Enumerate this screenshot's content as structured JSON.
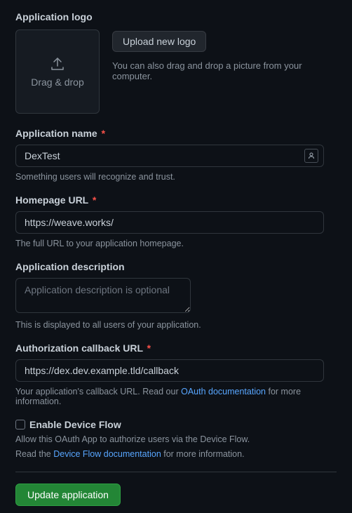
{
  "logo": {
    "heading": "Application logo",
    "dropText": "Drag & drop",
    "uploadButton": "Upload new logo",
    "hint": "You can also drag and drop a picture from your computer."
  },
  "appName": {
    "label": "Application name",
    "value": "DexTest",
    "help": "Something users will recognize and trust."
  },
  "homepage": {
    "label": "Homepage URL",
    "value": "https://weave.works/",
    "help": "The full URL to your application homepage."
  },
  "description": {
    "label": "Application description",
    "placeholder": "Application description is optional",
    "help": "This is displayed to all users of your application."
  },
  "callback": {
    "label": "Authorization callback URL",
    "value": "https://dex.dev.example.tld/callback",
    "helpPrefix": "Your application's callback URL. Read our ",
    "helpLink": "OAuth documentation",
    "helpSuffix": " for more information."
  },
  "deviceFlow": {
    "label": "Enable Device Flow",
    "help1": "Allow this OAuth App to authorize users via the Device Flow.",
    "help2Prefix": "Read the ",
    "help2Link": "Device Flow documentation",
    "help2Suffix": " for more information."
  },
  "submit": {
    "label": "Update application"
  },
  "asterisk": "*"
}
